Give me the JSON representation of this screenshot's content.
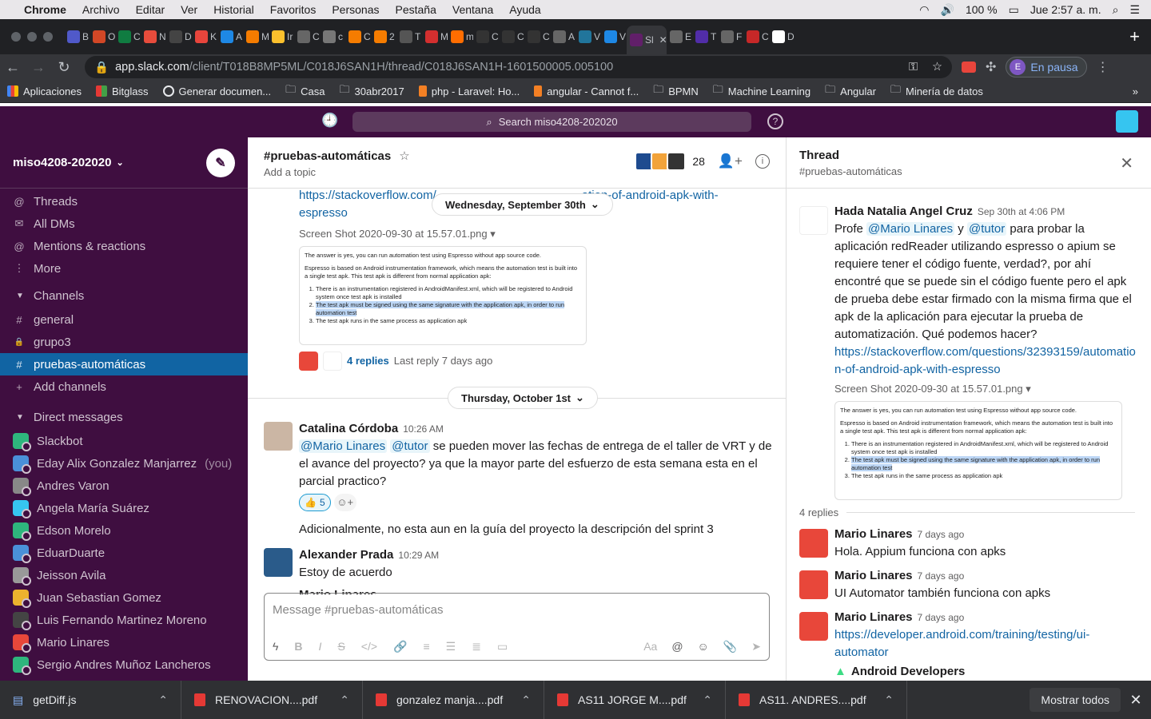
{
  "mac_menu": {
    "apple_icon": "apple-icon",
    "app": "Chrome",
    "items": [
      "Archivo",
      "Editar",
      "Ver",
      "Historial",
      "Favoritos",
      "Personas",
      "Pestaña",
      "Ventana",
      "Ayuda"
    ],
    "battery": "100 %",
    "clock": "Jue 2:57 a. m."
  },
  "tabs": [
    {
      "label": "B",
      "color": "#5059c9"
    },
    {
      "label": "O",
      "color": "#d24726"
    },
    {
      "label": "C",
      "color": "#107c41"
    },
    {
      "label": "N",
      "color": "#e74c3c"
    },
    {
      "label": "D",
      "color": "#444"
    },
    {
      "label": "K",
      "color": "#e8453c"
    },
    {
      "label": "A",
      "color": "#1e88e5"
    },
    {
      "label": "M",
      "color": "#f57c00"
    },
    {
      "label": "Ir",
      "color": "#fbc02d"
    },
    {
      "label": "C",
      "color": "#666"
    },
    {
      "label": "c",
      "color": "#777"
    },
    {
      "label": "C",
      "color": "#f57c00"
    },
    {
      "label": "2",
      "color": "#f57c00"
    },
    {
      "label": "T",
      "color": "#555"
    },
    {
      "label": "M",
      "color": "#d32f2f"
    },
    {
      "label": "m",
      "color": "#ff6d00"
    },
    {
      "label": "C",
      "color": "#333"
    },
    {
      "label": "C",
      "color": "#333"
    },
    {
      "label": "C",
      "color": "#333"
    },
    {
      "label": "A",
      "color": "#666"
    },
    {
      "label": "V",
      "color": "#21759b"
    },
    {
      "label": "V",
      "color": "#1e88e5"
    },
    {
      "label": "Sl",
      "color": "#611f69"
    },
    {
      "label": "E",
      "color": "#666"
    },
    {
      "label": "T",
      "color": "#512da8"
    },
    {
      "label": "F",
      "color": "#666"
    },
    {
      "label": "C",
      "color": "#c62828"
    },
    {
      "label": "D",
      "color": "#fff"
    }
  ],
  "newtab_label": "+",
  "url": {
    "domain": "app.slack.com",
    "path": "/client/T018B8MP5ML/C018J6SAN1H/thread/C018J6SAN1H-1601500005.005100"
  },
  "profile": {
    "initial": "E",
    "label": "En pausa"
  },
  "bookmarks": [
    "Aplicaciones",
    "Bitglass",
    "Generar documen...",
    "Casa",
    "30abr2017",
    "php - Laravel: Ho...",
    "angular - Cannot f...",
    "BPMN",
    "Machine Learning",
    "Angular",
    "Minería de datos"
  ],
  "slack": {
    "search_placeholder": "Search miso4208-202020",
    "workspace": "miso4208-202020",
    "nav": [
      {
        "icon": "threads-icon",
        "glyph": "@",
        "label": "Threads"
      },
      {
        "icon": "dms-icon",
        "glyph": "✉",
        "label": "All DMs"
      },
      {
        "icon": "mentions-icon",
        "glyph": "@",
        "label": "Mentions & reactions"
      },
      {
        "icon": "more-icon",
        "glyph": "⋮",
        "label": "More"
      }
    ],
    "channels_header": "Channels",
    "channels": [
      {
        "glyph": "#",
        "label": "general"
      },
      {
        "glyph": "🔒",
        "label": "grupo3"
      },
      {
        "glyph": "#",
        "label": "pruebas-automáticas",
        "active": true
      },
      {
        "glyph": "+",
        "label": "Add channels"
      }
    ],
    "dm_header": "Direct messages",
    "dms": [
      {
        "name": "Slackbot",
        "color": "#2eb67d"
      },
      {
        "name": "Eday Alix Gonzalez Manjarrez",
        "you": "(you)",
        "color": "#4a90d9"
      },
      {
        "name": "Andres Varon",
        "color": "#888"
      },
      {
        "name": "Angela María Suárez",
        "color": "#36c5f0"
      },
      {
        "name": "Edson Morelo",
        "color": "#2eb67d"
      },
      {
        "name": "EduarDuarte",
        "color": "#4a90d9"
      },
      {
        "name": "Jeisson Avila",
        "color": "#999"
      },
      {
        "name": "Juan Sebastian Gomez",
        "color": "#ecb22e"
      },
      {
        "name": "Luis Fernando Martinez Moreno",
        "color": "#444"
      },
      {
        "name": "Mario Linares",
        "color": "#e8473a"
      },
      {
        "name": "Sergio Andres Muñoz Lancheros",
        "color": "#2eb67d"
      }
    ],
    "channel": {
      "name": "#pruebas-automáticas",
      "topic": "Add a topic",
      "member_count": "28"
    },
    "messages": {
      "top_link": "https://stackoverflow.com/questions/32393159/automation-of-android-apk-with-espresso",
      "top_link_visible": "https://stackoverflow.com/",
      "top_link_tail": "ation-of-android-apk-with-",
      "top_link_line2": "espresso",
      "date1": "Wednesday, September 30th",
      "file_name": "Screen Shot 2020-09-30 at 15.57.01.png",
      "replies": "4 replies",
      "last_reply": "Last reply 7 days ago",
      "date2": "Thursday, October 1st",
      "m1_name": "Catalina Córdoba",
      "m1_time": "10:26 AM",
      "m1_mention1": "@Mario Linares",
      "m1_mention2": "@tutor",
      "m1_text": " se pueden mover las fechas de entrega de el taller de VRT y de el avance del proyecto? ya que la mayor parte del esfuerzo de esta semana esta en el parcial practico?",
      "m1_reaction": "👍",
      "m1_reaction_count": "5",
      "m1_followup": "Adicionalmente, no esta aun en la guía del proyecto la descripción del sprint 3",
      "m2_name": "Alexander Prada",
      "m2_time": "10:29 AM",
      "m2_text": "Estoy de acuerdo",
      "m3_partial": "Mario Linares"
    },
    "screenshot_text": {
      "p1": "The answer is yes, you can run automation test using Espresso without app source code.",
      "p2": "Espresso is based on Android instrumentation framework, which means the automation test is built into a single test apk. This test apk is different from normal application apk:",
      "li1": "There is an instrumentation registered in AndroidManifest.xml, which will be registered to Android system once test apk is installed",
      "li2": "The test apk must be signed using the same signature with the application apk, in order to run automation test",
      "li3": "The test apk runs in the same process as application apk"
    },
    "composer_placeholder": "Message #pruebas-automáticas",
    "thread": {
      "title": "Thread",
      "channel": "#pruebas-automáticas",
      "op_name": "Hada Natalia Angel Cruz",
      "op_time": "Sep 30th at 4:06 PM",
      "op_pre": "Profe ",
      "op_m1": "@Mario Linares",
      "op_mid": " y ",
      "op_m2": "@tutor",
      "op_text": " para probar la aplicación redReader utilizando espresso o apium se requiere tener el código fuente, verdad?, por ahí encontré que se puede sin el código fuente pero el apk de prueba debe estar firmado con la misma firma que el apk de la aplicación para ejecutar la prueba de automatización. Qué podemos hacer?",
      "op_link": "https://stackoverflow.com/questions/32393159/automation-of-android-apk-with-espresso",
      "file_name": "Screen Shot 2020-09-30 at 15.57.01.png",
      "reply_count": "4 replies",
      "replies": [
        {
          "name": "Mario Linares",
          "time": "7 days ago",
          "text": "Hola. Appium funciona con  apks"
        },
        {
          "name": "Mario Linares",
          "time": "7 days ago",
          "text": "UI Automator también funciona con apks"
        },
        {
          "name": "Mario Linares",
          "time": "7 days ago",
          "text": "https://developer.android.com/training/testing/ui-automator"
        }
      ],
      "preview_title": "Android Developers"
    }
  },
  "downloads": [
    "getDiff.js",
    "RENOVACION....pdf",
    "gonzalez manja....pdf",
    "AS11 JORGE M....pdf",
    "AS11. ANDRES....pdf"
  ],
  "show_all": "Mostrar todos"
}
